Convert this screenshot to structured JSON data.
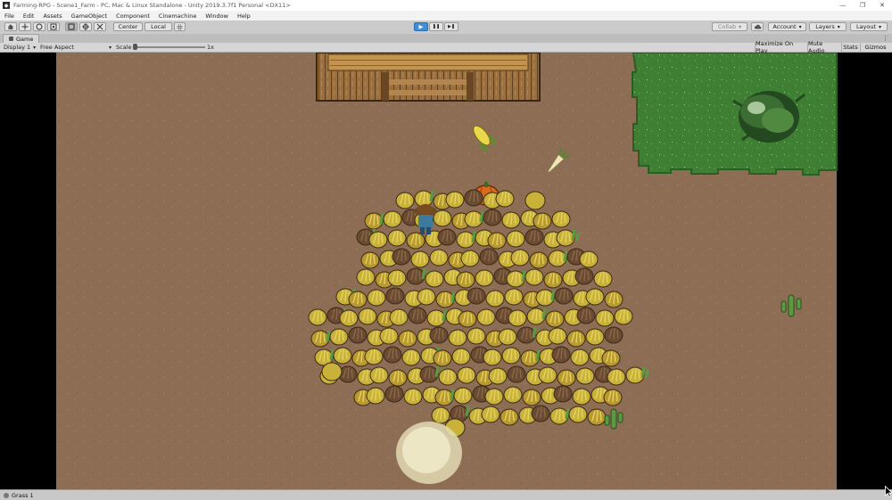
{
  "window": {
    "title": "Farming-RPG - Scene1_Farm - PC, Mac & Linux Standalone - Unity 2019.3.7f1 Personal <DX11>",
    "minimize": "—",
    "maximize": "❐",
    "close": "✕"
  },
  "menu": [
    "File",
    "Edit",
    "Assets",
    "GameObject",
    "Component",
    "Cinemachine",
    "Window",
    "Help"
  ],
  "toolbar": {
    "pivot_label": "Center",
    "space_label": "Local",
    "play_icon": "▶",
    "pause_icon": "❚❚",
    "step_icon": "▶❚",
    "collab_label": "Collab",
    "account_label": "Account",
    "layers_label": "Layers",
    "layout_label": "Layout"
  },
  "tab": {
    "label": "Game",
    "menu": "⋮"
  },
  "game_bar": {
    "display": "Display 1",
    "aspect": "Free Aspect",
    "scale_label": "Scale",
    "scale_value": "1x",
    "scale_level": 0.0,
    "maximize": "Maximize On Play",
    "mute": "Mute Audio",
    "stats": "Stats",
    "gizmos": "Gizmos"
  },
  "status": {
    "text": "Grass 1"
  },
  "colors": {
    "dirt": "#8d6e55",
    "grass": "#3f7f33",
    "play_accent": "#3e8ed8",
    "pumpkin": "#d86a1e",
    "corn": "#e8d84a"
  },
  "icons": [
    "hand-tool-icon",
    "move-tool-icon",
    "rotate-tool-icon",
    "scale-tool-icon",
    "rect-tool-icon",
    "transform-tool-icon",
    "custom-tool-icon",
    "play-icon",
    "pause-icon",
    "step-icon",
    "cloud-icon"
  ]
}
